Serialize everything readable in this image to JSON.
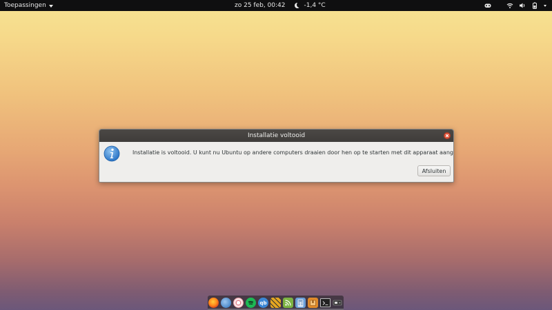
{
  "topbar": {
    "activities_label": "Toepassingen",
    "datetime": "zo 25 feb, 00:42",
    "weather_temp": "-1,4 °C"
  },
  "dialog": {
    "title": "Installatie voltooid",
    "message": "Installatie is voltooid. U kunt nu Ubuntu op andere computers draaien door hen op te starten met dit apparaat aangesloten.",
    "close_button_label": "Afsluiten"
  },
  "dock": {
    "apps": [
      {
        "name": "firefox-icon",
        "color": "#e66000"
      },
      {
        "name": "thunderbird-icon",
        "color": "#2a6fb8"
      },
      {
        "name": "candy-icon",
        "color": "#e0707c"
      },
      {
        "name": "spotify-icon",
        "color": "#1db954"
      },
      {
        "name": "qbittorrent-icon",
        "color": "#3b87d6",
        "label": "qb"
      },
      {
        "name": "puzzle-icon",
        "color": "#e3a521"
      },
      {
        "name": "feed-icon",
        "color": "#7cb342"
      },
      {
        "name": "calculator-icon",
        "color": "#6a9ed8"
      },
      {
        "name": "archive-icon",
        "color": "#e08a2a"
      },
      {
        "name": "terminal-icon",
        "color": "#222222"
      },
      {
        "name": "usb-creator-icon",
        "color": "#555555"
      }
    ]
  }
}
